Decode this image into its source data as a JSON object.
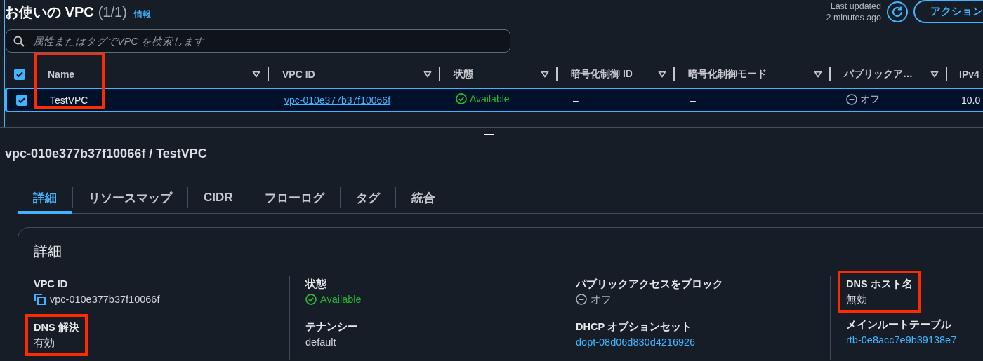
{
  "list": {
    "title": "お使いの VPC",
    "count": "(1/1)",
    "info_link": "情報",
    "last_updated": [
      "Last updated",
      "2 minutes ago"
    ],
    "actions_button": "アクション",
    "search": {
      "placeholder": "属性またはタグでVPC を検索します"
    }
  },
  "table": {
    "all_checked": true,
    "columns": [
      {
        "label": "Name",
        "highlighted": true
      },
      {
        "label": "VPC ID",
        "highlighted": false
      },
      {
        "label": "状態",
        "highlighted": false
      },
      {
        "label": "暗号化制御 ID",
        "highlighted": false
      },
      {
        "label": "暗号化制御モード",
        "highlighted": false
      },
      {
        "label": "パブリックア…",
        "highlighted": false
      },
      {
        "label": "IPv4",
        "highlighted": false
      }
    ],
    "rows": [
      {
        "selected": true,
        "cells": [
          {
            "kind": "text",
            "text": "TestVPC"
          },
          {
            "kind": "link",
            "text": "vpc-010e377b37f10066f"
          },
          {
            "kind": "status",
            "text": "Available"
          },
          {
            "kind": "text",
            "text": "–"
          },
          {
            "kind": "text",
            "text": "–"
          },
          {
            "kind": "off",
            "text": "オフ"
          },
          {
            "kind": "text",
            "text": "10.0"
          }
        ]
      }
    ]
  },
  "details": {
    "title": "vpc-010e377b37f10066f / TestVPC",
    "tabs": [
      {
        "label": "詳細",
        "selected": true
      },
      {
        "label": "リソースマップ",
        "selected": false
      },
      {
        "label": "CIDR",
        "selected": false
      },
      {
        "label": "フローログ",
        "selected": false
      },
      {
        "label": "タグ",
        "selected": false
      },
      {
        "label": "統合",
        "selected": false
      }
    ],
    "section_title": "詳細",
    "columns": [
      {
        "fields": [
          {
            "label": "VPC ID",
            "kind": "copy",
            "value": "vpc-010e377b37f10066f",
            "highlighted": false
          },
          {
            "label": "DNS 解決",
            "kind": "text",
            "value": "有効",
            "highlighted": true
          }
        ]
      },
      {
        "fields": [
          {
            "label": "状態",
            "kind": "status",
            "value": "Available",
            "highlighted": false
          },
          {
            "label": "テナンシー",
            "kind": "text",
            "value": "default",
            "highlighted": false
          }
        ]
      },
      {
        "fields": [
          {
            "label": "パブリックアクセスをブロック",
            "kind": "off",
            "value": "オフ",
            "highlighted": false
          },
          {
            "label": "DHCP オプションセット",
            "kind": "link",
            "value": "dopt-08d06d830d4216926",
            "highlighted": false
          }
        ]
      },
      {
        "fields": [
          {
            "label": "DNS ホスト名",
            "kind": "text",
            "value": "無効",
            "highlighted": true
          },
          {
            "label": "メインルートテーブル",
            "kind": "link",
            "value": "rtb-0e8acc7e9b39138e7",
            "highlighted": false
          }
        ]
      }
    ]
  }
}
